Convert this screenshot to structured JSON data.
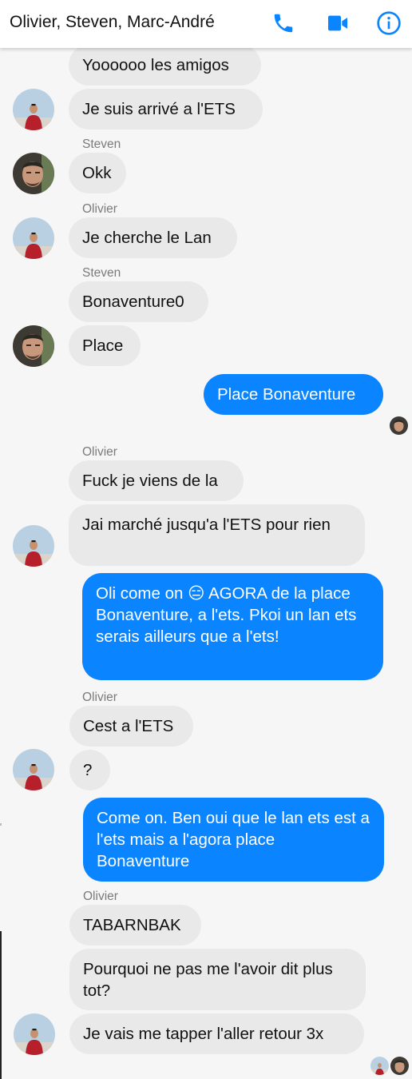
{
  "header": {
    "title": "Olivier, Steven, Marc-André",
    "icons": {
      "call": "phone-icon",
      "video": "video-camera-icon",
      "info": "info-icon"
    },
    "accent_color": "#0a84ff"
  },
  "messages": [
    {
      "text": "Yoooooo les amigos",
      "from": "Olivier"
    },
    {
      "text": "Je suis arrivé a l'ETS",
      "from": "Olivier"
    },
    {
      "sender_label": "Steven"
    },
    {
      "text": "Okk",
      "from": "Steven"
    },
    {
      "sender_label": "Olivier"
    },
    {
      "text": "Je cherche le Lan",
      "from": "Olivier"
    },
    {
      "sender_label": "Steven"
    },
    {
      "text": "Bonaventure0",
      "from": "Steven"
    },
    {
      "text": "Place",
      "from": "Steven"
    },
    {
      "text": "Place Bonaventure",
      "from": "me"
    },
    {
      "sender_label": "Olivier"
    },
    {
      "text": "Fuck je viens de la",
      "from": "Olivier"
    },
    {
      "text": "Jai marché jusqu'a l'ETS pour rien",
      "from": "Olivier"
    },
    {
      "text": "Oli come on 😑 AGORA de la place Bonaventure, a l'ets. Pkoi un lan ets serais ailleurs que a l'ets!",
      "from": "me"
    },
    {
      "sender_label": "Olivier"
    },
    {
      "text": "Cest a l'ETS",
      "from": "Olivier"
    },
    {
      "text": "?",
      "from": "Olivier"
    },
    {
      "text": "Come on. Ben oui que le lan ets est a l'ets mais a l'agora place Bonaventure",
      "from": "me"
    },
    {
      "sender_label": "Olivier"
    },
    {
      "text": "TABARNBAK",
      "from": "Olivier"
    },
    {
      "text": "Pourquoi ne pas me l'avoir dit plus tot?",
      "from": "Olivier"
    },
    {
      "text": "Je vais me tapper l'aller retour 3x",
      "from": "Olivier"
    }
  ],
  "colors": {
    "incoming_bubble": "#e9e9e9",
    "outgoing_bubble": "#0a84ff",
    "background": "#f6f6f6"
  }
}
